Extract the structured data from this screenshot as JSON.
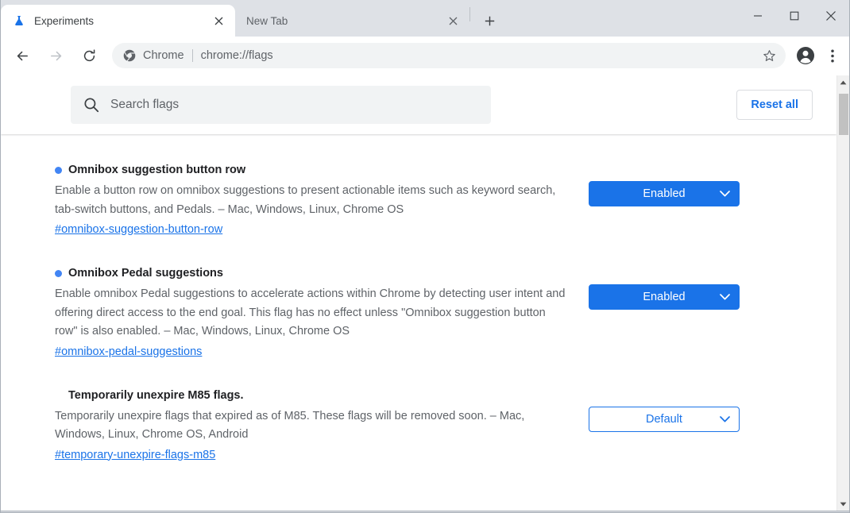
{
  "browser": {
    "tabs": [
      {
        "title": "Experiments",
        "favicon": "flask-icon",
        "active": true,
        "close_label": "close-tab"
      },
      {
        "title": "New Tab",
        "favicon": "none",
        "active": false,
        "close_label": "close-tab"
      }
    ],
    "new_tab_button": "+",
    "window_controls": {
      "minimize": "minimize",
      "maximize": "maximize",
      "close": "close"
    },
    "toolbar": {
      "back": "back-arrow-icon",
      "forward": "forward-arrow-icon",
      "reload": "reload-icon",
      "chrome_badge": "Chrome",
      "url": "chrome://flags",
      "bookmark": "star-icon",
      "profile": "profile-avatar-icon",
      "menu": "three-dot-menu-icon"
    }
  },
  "page": {
    "search": {
      "placeholder": "Search flags",
      "value": "",
      "icon": "search-icon"
    },
    "reset_all_label": "Reset all",
    "flags": [
      {
        "modified": true,
        "title": "Omnibox suggestion button row",
        "description": "Enable a button row on omnibox suggestions to present actionable items such as keyword search, tab-switch buttons, and Pedals. – Mac, Windows, Linux, Chrome OS",
        "link": "#omnibox-suggestion-button-row",
        "state": "Enabled",
        "state_style": "enabled"
      },
      {
        "modified": true,
        "title": "Omnibox Pedal suggestions",
        "description": "Enable omnibox Pedal suggestions to accelerate actions within Chrome by detecting user intent and offering direct access to the end goal. This flag has no effect unless \"Omnibox suggestion button row\" is also enabled. – Mac, Windows, Linux, Chrome OS",
        "link": "#omnibox-pedal-suggestions",
        "state": "Enabled",
        "state_style": "enabled"
      },
      {
        "modified": false,
        "title": "Temporarily unexpire M85 flags.",
        "description": "Temporarily unexpire flags that expired as of M85. These flags will be removed soon. – Mac, Windows, Linux, Chrome OS, Android",
        "link": "#temporary-unexpire-flags-m85",
        "state": "Default",
        "state_style": "default"
      }
    ]
  },
  "colors": {
    "accent_blue": "#1a73e8",
    "dot_blue": "#4285f4",
    "chrome_frame": "#dee1e6",
    "text_primary": "#202124",
    "text_secondary": "#5f6368"
  }
}
